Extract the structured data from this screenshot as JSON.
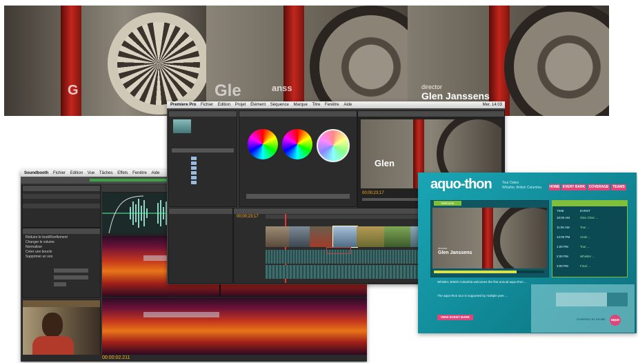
{
  "filmstrip": {
    "frame1_text": "G",
    "frame2_ghost_text": "Gle",
    "frame2_partial_text": "anss",
    "frame3_role": "director",
    "frame3_name": "Glen Janssens"
  },
  "premiere": {
    "menu": [
      "Premiere Pro",
      "Fichier",
      "Edition",
      "Projet",
      "Élément",
      "Séquence",
      "Marque",
      "Titre",
      "Fenêtre",
      "Aide"
    ],
    "clock": "Mer. 14:03",
    "monitor_timecode": "00;00;23;17",
    "timeline_timecode": "00;00;23;17",
    "monitor_overlay_text": "Glen"
  },
  "soundbooth": {
    "menu": [
      "Soundbooth",
      "Fichier",
      "Edition",
      "Vue",
      "Tâches",
      "Effets",
      "Fenêtre",
      "Aide"
    ],
    "tasks": [
      "Réduire le bruit/Ronflement",
      "Changer le volume",
      "Normaliser",
      "Créer une boucle",
      "Supprimer un son"
    ],
    "time": "00:00:02.211"
  },
  "aquothon": {
    "logo": "aquo-thon",
    "tagline_line1": "Tour Dates",
    "tagline_line2": "Whistler, British Columbia",
    "nav": [
      "HOME",
      "EVERY BARK",
      "COVERAGE",
      "TEAMS"
    ],
    "video_label": "Welcome",
    "video_credit_role": "director",
    "video_credit_name": "Glen Janssens",
    "schedule_headers": [
      "TIME",
      "EVENT"
    ],
    "schedule": [
      {
        "time": "10:00 AM",
        "event": "Glen Chez ..."
      },
      {
        "time": "11:00 AM",
        "event": "Tour ..."
      },
      {
        "time": "12:00 PM",
        "event": "Arnie ..."
      },
      {
        "time": "1:00 PM",
        "event": "Tour ..."
      },
      {
        "time": "2:00 PM",
        "event": "Whistler ..."
      },
      {
        "time": "3:00 PM",
        "event": "Final ..."
      }
    ],
    "body_paragraph_1": "Whistler, British Columbia welcomes the first annual aquo-thon ...",
    "body_paragraph_2": "The aquo-thon tour is supported by multiple peer ...",
    "view_button": "VIEW EVENT BARK",
    "footer_text": "POWERED BY ADOBE",
    "footer_badge": "aquo",
    "colors": {
      "accent": "#e0457a",
      "bg": "#1aa6b5",
      "panel_green": "#7fbf3a"
    }
  }
}
